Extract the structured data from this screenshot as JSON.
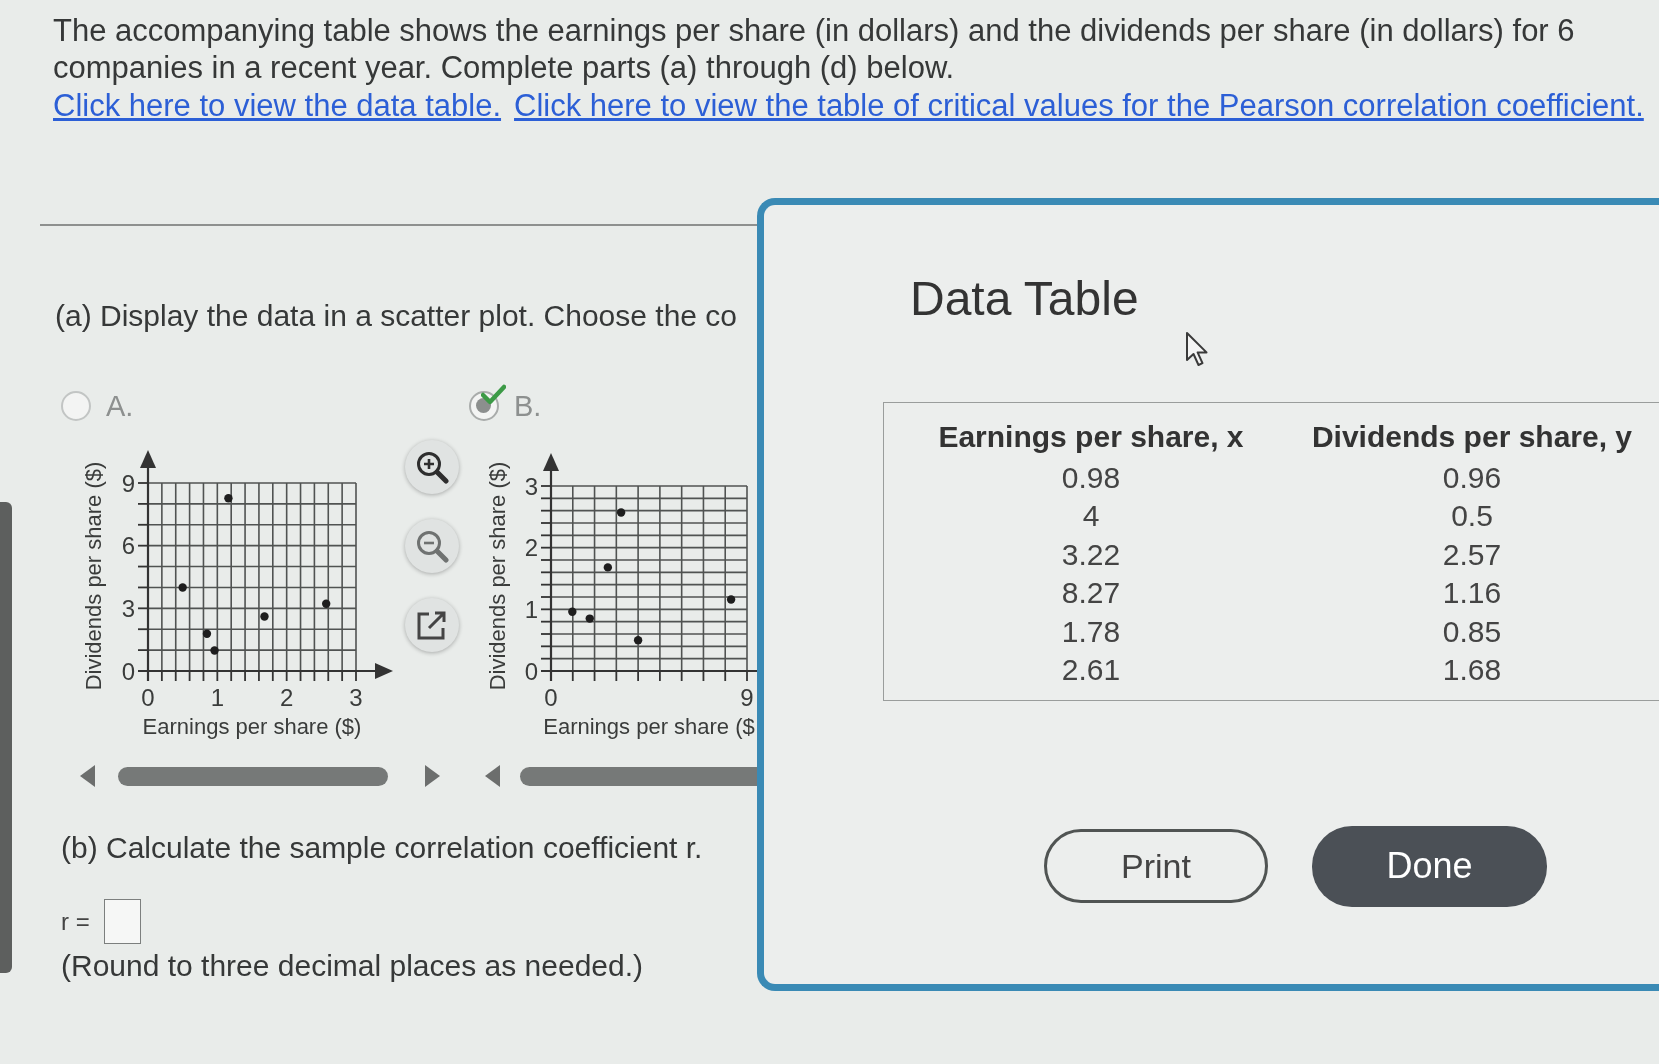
{
  "problem": {
    "statement": "The accompanying table shows the earnings per share (in dollars) and the dividends per share (in dollars) for 6 companies in a recent year. Complete parts (a) through (d) below.",
    "links": [
      "Click here to view the data table.",
      "Click here to view the table of critical values for the Pearson correlation coefficient."
    ]
  },
  "part_a": {
    "prompt": "(a) Display the data in a scatter plot. Choose the co",
    "options": [
      {
        "label": "A.",
        "selected": false,
        "correct": false,
        "chart_data": {
          "type": "scatter",
          "xlabel": "Earnings per share ($)",
          "ylabel": "Dividends per share ($)",
          "x": [
            0.96,
            0.5,
            2.57,
            1.16,
            0.85,
            1.68
          ],
          "values": [
            0.98,
            4,
            3.22,
            8.27,
            1.78,
            2.61
          ],
          "xlim": [
            0,
            3
          ],
          "ylim": [
            0,
            9
          ],
          "xticks": [
            0,
            1,
            2,
            3
          ],
          "yticks": [
            0,
            3,
            6,
            9
          ],
          "grid": true
        }
      },
      {
        "label": "B.",
        "selected": true,
        "correct": true,
        "chart_data": {
          "type": "scatter",
          "xlabel": "Earnings per share ($",
          "ylabel": "Dividends per share ($)",
          "x": [
            0.98,
            4,
            3.22,
            8.27,
            1.78,
            2.61
          ],
          "values": [
            0.96,
            0.5,
            2.57,
            1.16,
            0.85,
            1.68
          ],
          "xlim": [
            0,
            9
          ],
          "ylim": [
            0,
            3
          ],
          "xticks": [
            0,
            9
          ],
          "yticks": [
            0,
            1,
            2,
            3
          ],
          "grid": true
        }
      }
    ]
  },
  "part_b": {
    "prompt": "(b) Calculate the sample correlation coefficient r.",
    "answer_label": "r =",
    "note": "(Round to three decimal places as needed.)"
  },
  "dialog": {
    "title": "Data Table",
    "columns": [
      "Earnings per share, x",
      "Dividends per share, y"
    ],
    "rows": [
      [
        "0.98",
        "0.96"
      ],
      [
        "4",
        "0.5"
      ],
      [
        "3.22",
        "2.57"
      ],
      [
        "8.27",
        "1.16"
      ],
      [
        "1.78",
        "0.85"
      ],
      [
        "2.61",
        "1.68"
      ]
    ],
    "buttons": [
      {
        "label": "Print",
        "kind": "outline"
      },
      {
        "label": "Done",
        "kind": "filled"
      }
    ]
  }
}
